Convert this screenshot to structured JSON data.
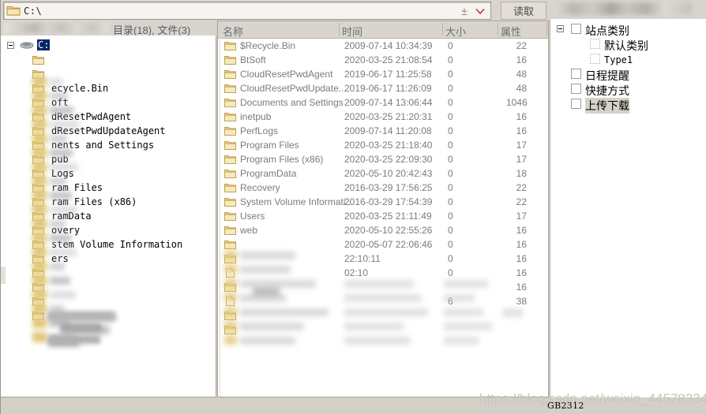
{
  "addressbar": {
    "path_value": "C:\\",
    "path_placeholder": "C:\\",
    "plus_label": "±",
    "read_button": "读取",
    "folder_icon": "folder-icon",
    "chevron_icon": "chevron-down-icon"
  },
  "statusbar": {
    "counts": "目录(18), 文件(3)"
  },
  "left_tree": {
    "root": {
      "label": "C:",
      "selected": true,
      "icon": "drive-icon"
    },
    "nodes": [
      {
        "label": "",
        "blurred": true
      },
      {
        "label": "",
        "blurred": true
      },
      {
        "label": "ecycle.Bin",
        "full": "$Recycle.Bin"
      },
      {
        "label": "oft",
        "full": "BtSoft"
      },
      {
        "label": "dResetPwdAgent",
        "full": "CloudResetPwdAgent"
      },
      {
        "label": "dResetPwdUpdateAgent",
        "full": "CloudResetPwdUpdateAgent"
      },
      {
        "label": "nents and Settings",
        "full": "Documents and Settings"
      },
      {
        "label": "pub",
        "full": "inetpub"
      },
      {
        "label": "Logs",
        "full": "PerfLogs"
      },
      {
        "label": "ram Files",
        "full": "Program Files"
      },
      {
        "label": "ram Files (x86)",
        "full": "Program Files (x86)"
      },
      {
        "label": "ramData",
        "full": "ProgramData"
      },
      {
        "label": "overy",
        "full": "Recovery"
      },
      {
        "label": "stem Volume Information",
        "full": "System Volume Information"
      },
      {
        "label": "ers",
        "full": "Users"
      },
      {
        "label": "",
        "blurred": true
      },
      {
        "label": "",
        "blurred": true
      },
      {
        "label": "",
        "blurred": true
      },
      {
        "label": "",
        "blurred": true
      }
    ]
  },
  "file_list": {
    "columns": [
      {
        "key": "name",
        "label": "名称"
      },
      {
        "key": "time",
        "label": "时间"
      },
      {
        "key": "size",
        "label": "大小"
      },
      {
        "key": "attr",
        "label": "属性"
      }
    ],
    "rows": [
      {
        "icon": "folder-icon",
        "name": "$Recycle.Bin",
        "time": "2009-07-14 10:34:39",
        "size": "0",
        "attr": "22"
      },
      {
        "icon": "folder-icon",
        "name": "BtSoft",
        "time": "2020-03-25 21:08:54",
        "size": "0",
        "attr": "16"
      },
      {
        "icon": "folder-icon",
        "name": "CloudResetPwdAgent",
        "time": "2019-06-17 11:25:58",
        "size": "0",
        "attr": "48"
      },
      {
        "icon": "folder-icon",
        "name": "CloudResetPwdUpdate...",
        "time": "2019-06-17 11:26:09",
        "size": "0",
        "attr": "48"
      },
      {
        "icon": "folder-icon",
        "name": "Documents and Settings",
        "time": "2009-07-14 13:06:44",
        "size": "0",
        "attr": "1046"
      },
      {
        "icon": "folder-icon",
        "name": "inetpub",
        "time": "2020-03-25 21:20:31",
        "size": "0",
        "attr": "16"
      },
      {
        "icon": "folder-icon",
        "name": "PerfLogs",
        "time": "2009-07-14 11:20:08",
        "size": "0",
        "attr": "16"
      },
      {
        "icon": "folder-icon",
        "name": "Program Files",
        "time": "2020-03-25 21:18:40",
        "size": "0",
        "attr": "17"
      },
      {
        "icon": "folder-icon",
        "name": "Program Files (x86)",
        "time": "2020-03-25 22:09:30",
        "size": "0",
        "attr": "17"
      },
      {
        "icon": "folder-icon",
        "name": "ProgramData",
        "time": "2020-05-10 20:42:43",
        "size": "0",
        "attr": "18"
      },
      {
        "icon": "folder-icon",
        "name": "Recovery",
        "time": "2016-03-29 17:56:25",
        "size": "0",
        "attr": "22"
      },
      {
        "icon": "folder-icon",
        "name": "System Volume Informati...",
        "time": "2016-03-29 17:54:39",
        "size": "0",
        "attr": "22"
      },
      {
        "icon": "folder-icon",
        "name": "Users",
        "time": "2020-03-25 21:11:49",
        "size": "0",
        "attr": "17"
      },
      {
        "icon": "folder-icon",
        "name": "web",
        "time": "2020-05-10 22:55:26",
        "size": "0",
        "attr": "16"
      },
      {
        "icon": "folder-icon",
        "name": "",
        "time": "2020-05-07 22:06:46",
        "size": "0",
        "attr": "16"
      },
      {
        "icon": "folder-icon",
        "name": "",
        "time": "22:10:11",
        "size": "0",
        "attr": "16"
      },
      {
        "icon": "file-icon",
        "name": "",
        "time": "02:10",
        "size": "0",
        "attr": "16"
      },
      {
        "icon": "folder-icon",
        "name": "",
        "time": "",
        "size": "",
        "attr": "16"
      },
      {
        "icon": "file-icon",
        "name": "",
        "time": "",
        "size": "6",
        "attr": "38"
      },
      {
        "icon": "folder-icon",
        "name": "",
        "time": "",
        "size": "",
        "attr": ""
      },
      {
        "icon": "folder-icon",
        "name": "",
        "time": "",
        "size": "",
        "attr": ""
      }
    ]
  },
  "right_tree": {
    "items": [
      {
        "label": "站点类别",
        "indent": 0,
        "twisty": true,
        "icon": "folder-outline-icon",
        "selected": false,
        "mono": false
      },
      {
        "label": "默认类别",
        "indent": 1,
        "twisty": false,
        "icon": "category-icon",
        "selected": false,
        "mono": false
      },
      {
        "label": "Type1",
        "indent": 1,
        "twisty": false,
        "icon": "category-icon",
        "selected": false,
        "mono": true
      },
      {
        "label": "日程提醒",
        "indent": 0,
        "twisty": false,
        "icon": "calendar-icon",
        "selected": false,
        "mono": false
      },
      {
        "label": "快捷方式",
        "indent": 0,
        "twisty": false,
        "icon": "shortcut-icon",
        "selected": false,
        "mono": false
      },
      {
        "label": "上传下载",
        "indent": 0,
        "twisty": false,
        "icon": "upload-download-icon",
        "selected": true,
        "mono": false
      }
    ]
  },
  "footer": {
    "encoding": "GB2312",
    "watermark": "https://blog.csdn.net/weixin_44578334"
  },
  "colors": {
    "chrome": "#d4d0c8",
    "panel_bg": "#ffffff",
    "selection": "#0a246a",
    "folder_yellow": "#e8c969",
    "text_muted": "#7b7b7b"
  }
}
